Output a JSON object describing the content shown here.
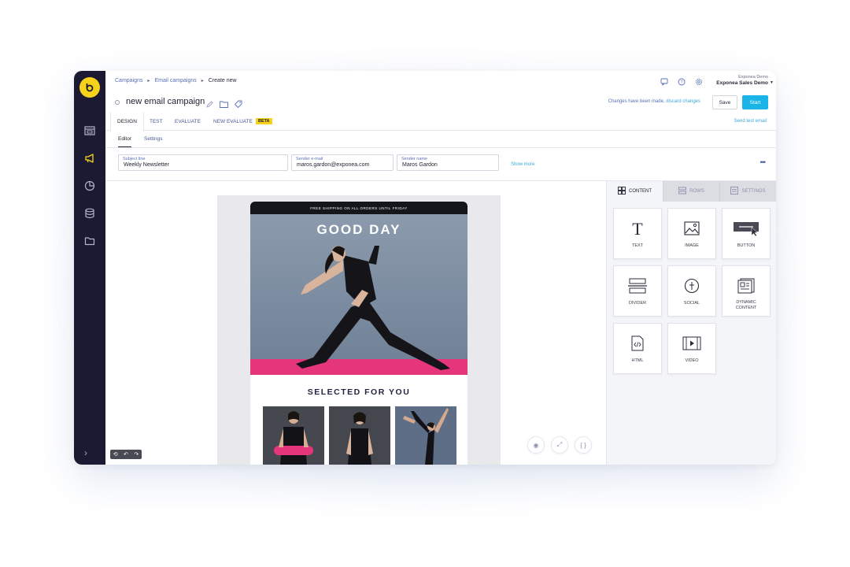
{
  "breadcrumb": {
    "item1": "Campaigns",
    "item2": "Email campaigns",
    "current": "Create new"
  },
  "account": {
    "org": "Exponea Demo",
    "project": "Exponea Sales Demo"
  },
  "campaign": {
    "title": "new email campaign"
  },
  "status": {
    "prefix": "Changes have been made,",
    "link": "discard changes"
  },
  "actions": {
    "save": "Save",
    "start": "Start"
  },
  "tabs": {
    "design": "DESIGN",
    "test": "TEST",
    "evaluate": "EVALUATE",
    "new_evaluate": "NEW EVALUATE",
    "beta": "BETA",
    "send_test": "Send test email"
  },
  "subtabs": {
    "editor": "Editor",
    "settings": "Settings"
  },
  "fields": {
    "subject": {
      "label": "Subject line",
      "value": "Weekly Newsletter"
    },
    "sender_email": {
      "label": "Sender e-mail",
      "value": "maros.gardon@exponea.com"
    },
    "sender_name": {
      "label": "Sender name",
      "value": "Maros Gardon"
    },
    "show_more": "Show more",
    "more": "•••"
  },
  "email": {
    "promo": "FREE SHIPPING ON ALL ORDERS UNTIL FRIDAY",
    "hero_title": "GOOD DAY",
    "selected_title": "SELECTED FOR YOU"
  },
  "panel": {
    "tabs": {
      "content": "CONTENT",
      "rows": "ROWS",
      "settings": "SETTINGS"
    },
    "blocks": {
      "text": "TEXT",
      "image": "IMAGE",
      "button": "BUTTON",
      "divider": "DIVIDER",
      "social": "SOCIAL",
      "dynamic_content": "DYNAMIC CONTENT",
      "html": "HTML",
      "video": "VIDEO"
    }
  },
  "colors": {
    "sidebar": "#1c1a33",
    "accent": "#19b4e8",
    "logo": "#f7d21c",
    "mat": "#e5357b"
  }
}
